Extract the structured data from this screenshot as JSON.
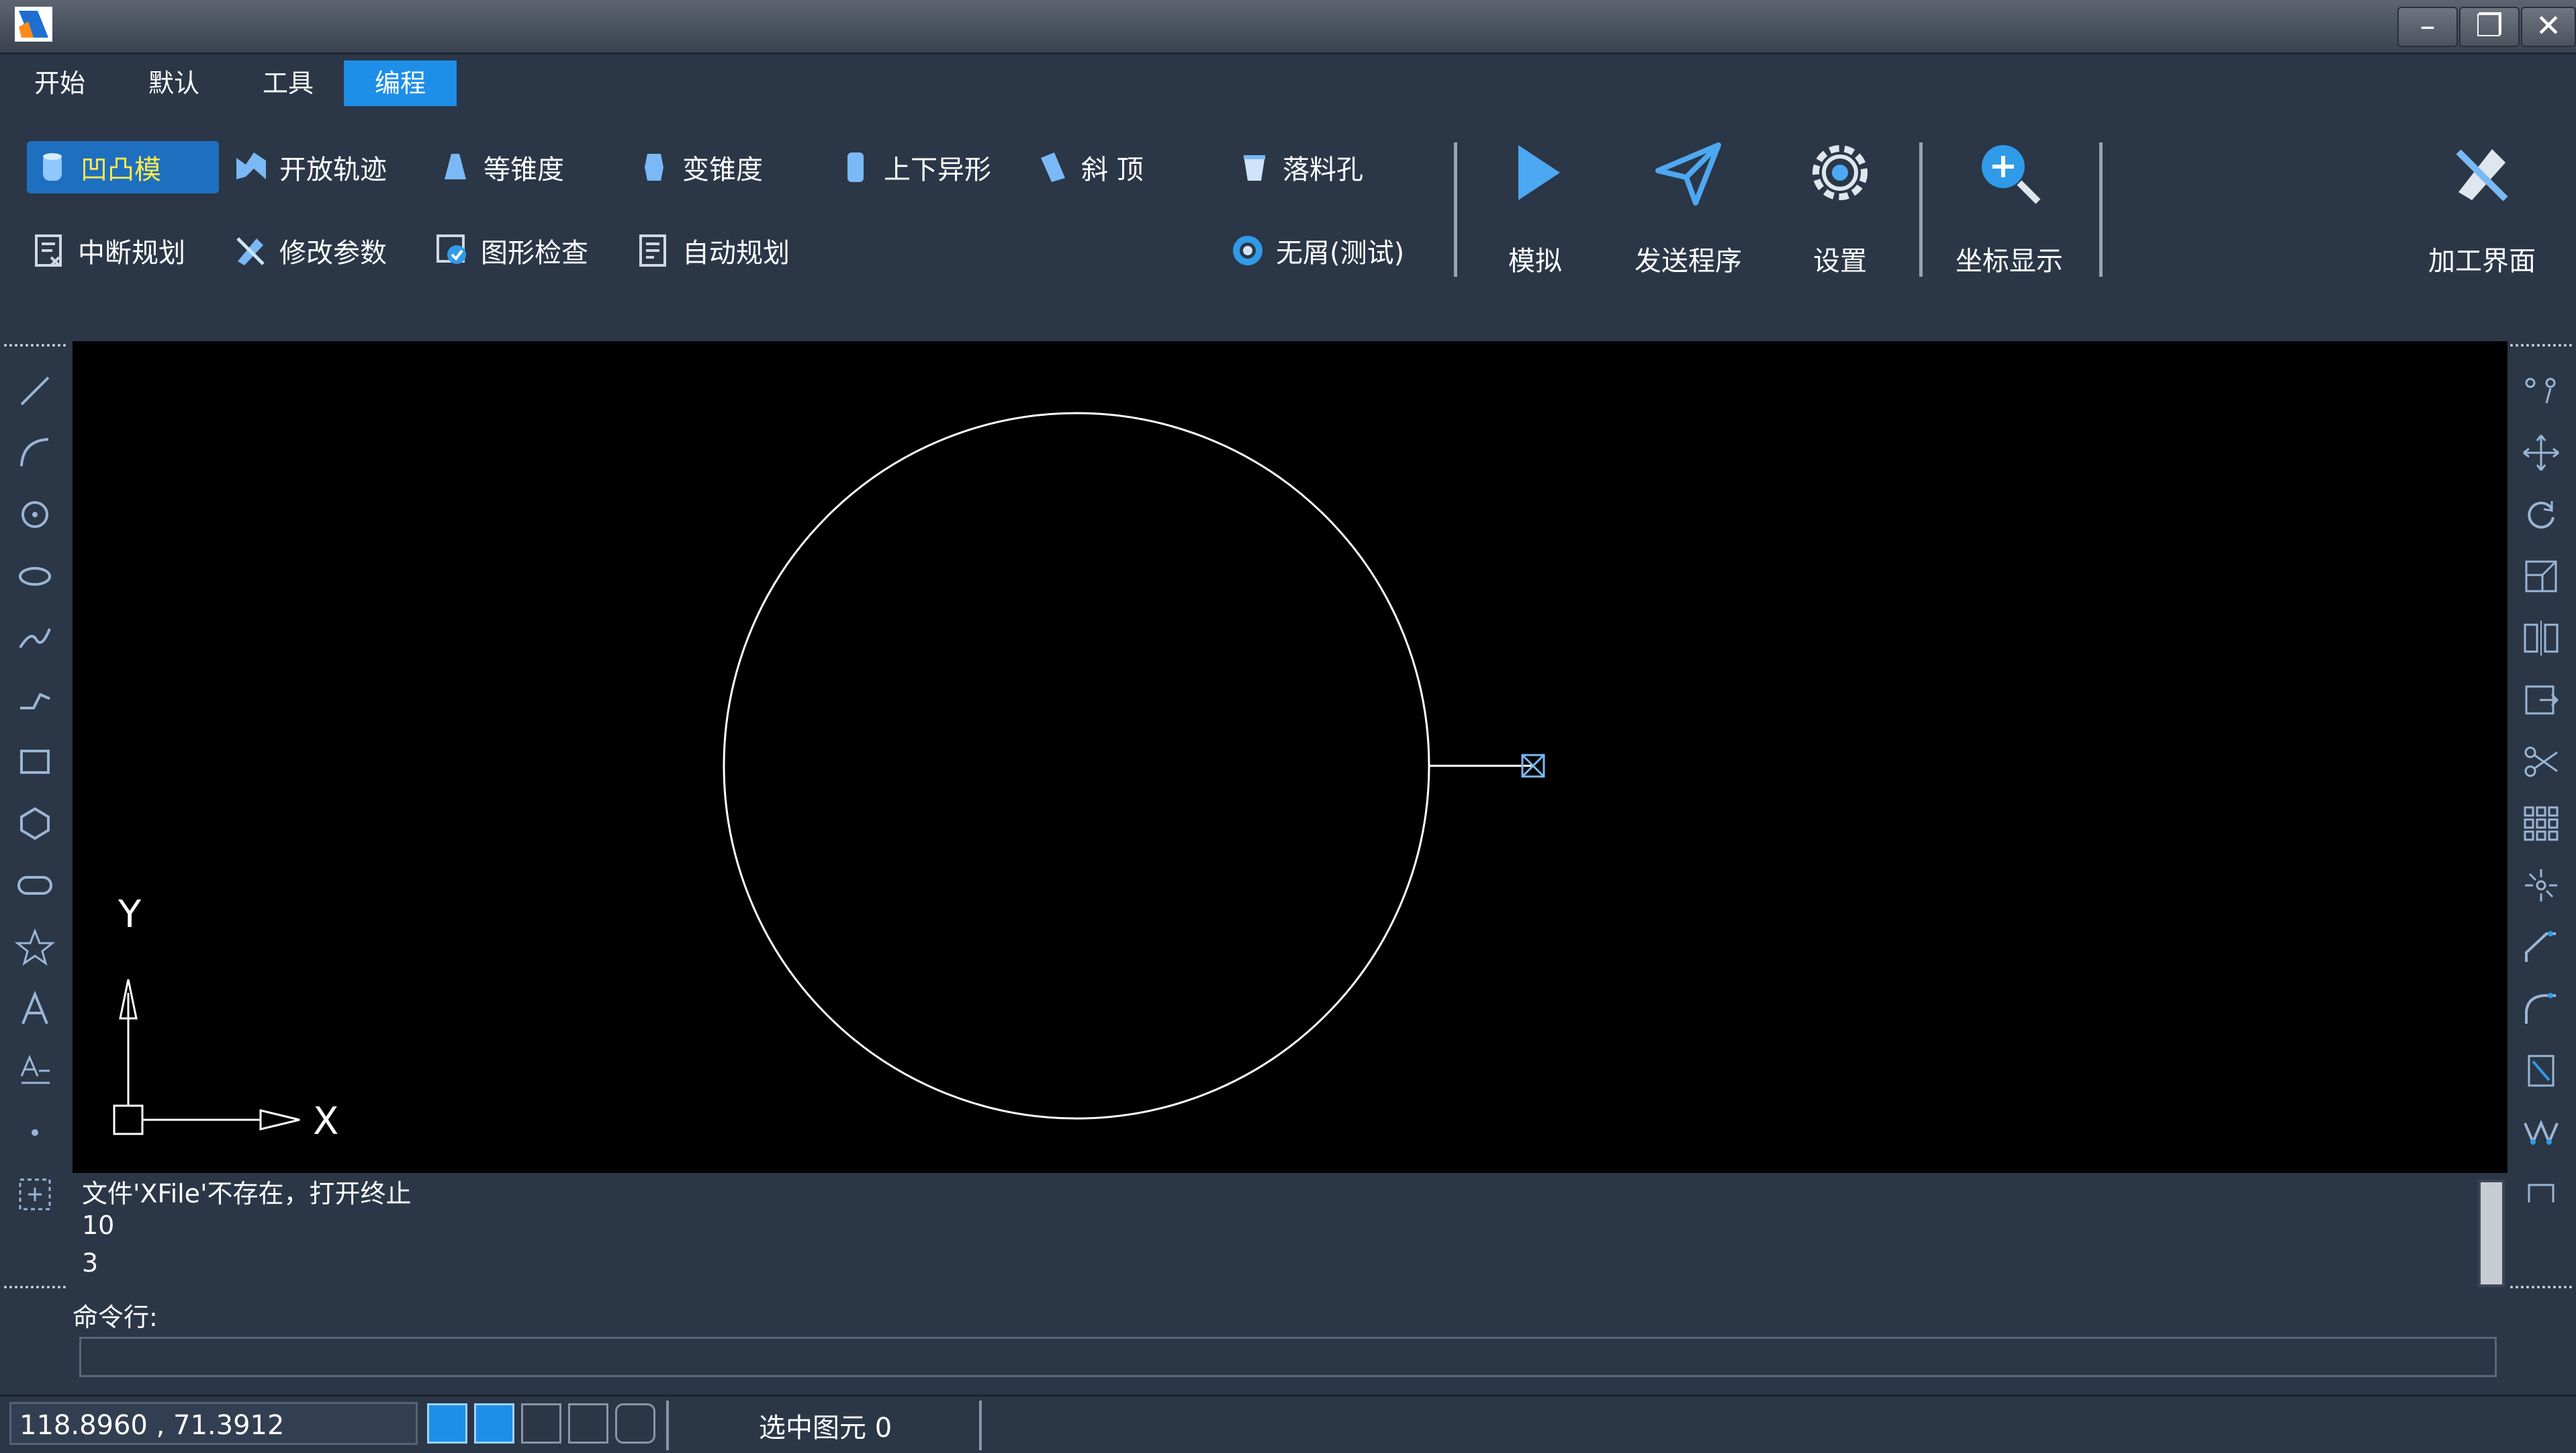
{
  "menu": {
    "tabs": [
      {
        "label": "开始"
      },
      {
        "label": "默认"
      },
      {
        "label": "工具"
      },
      {
        "label": "编程",
        "active": true
      }
    ]
  },
  "ribbon": {
    "row1": [
      {
        "label": "凹凸模",
        "icon": "cylinder-icon",
        "selected": true
      },
      {
        "label": "开放轨迹",
        "icon": "open-path-icon"
      },
      {
        "label": "等锥度",
        "icon": "cone-icon"
      },
      {
        "label": "变锥度",
        "icon": "variable-taper-icon"
      },
      {
        "label": "上下异形",
        "icon": "different-shape-icon"
      },
      {
        "label": "斜 顶",
        "icon": "slant-top-icon"
      },
      {
        "label": "落料孔",
        "icon": "blanking-hole-icon"
      }
    ],
    "row2": [
      {
        "label": "中断规划",
        "icon": "interrupt-plan-icon"
      },
      {
        "label": "修改参数",
        "icon": "modify-params-icon"
      },
      {
        "label": "图形检查",
        "icon": "shape-check-icon"
      },
      {
        "label": "自动规划",
        "icon": "auto-plan-icon"
      },
      {
        "label": "无屑(测试)",
        "icon": "no-chip-icon"
      }
    ],
    "big": [
      {
        "label": "模拟",
        "icon": "play-icon"
      },
      {
        "label": "发送程序",
        "icon": "send-icon"
      },
      {
        "label": "设置",
        "icon": "gear-icon"
      },
      {
        "label": "坐标显示",
        "icon": "zoom-in-icon"
      },
      {
        "label": "加工界面",
        "icon": "machining-icon"
      }
    ]
  },
  "canvas": {
    "axis_x_label": "X",
    "axis_y_label": "Y"
  },
  "console": {
    "lines": [
      "文件'XFile'不存在，打开终止",
      "10",
      "3"
    ],
    "command_label": "命令行:",
    "command_value": ""
  },
  "status": {
    "coordinates": "118.8960 , 71.3912",
    "selected": "选中图元 0"
  },
  "colors": {
    "background": "#2b3647",
    "accent": "#1e8fe8",
    "canvas": "#000000",
    "highlight_text": "#ffe94a"
  }
}
